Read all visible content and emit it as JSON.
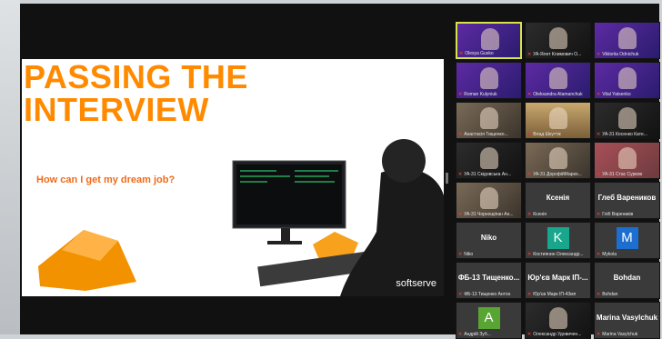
{
  "slide": {
    "title_line1": "PASSING THE",
    "title_line2": "INTERVIEW",
    "subtitle": "How can I get my dream job?",
    "brand": "softserve"
  },
  "participants": [
    {
      "label": "Olesya Gusko",
      "type": "video",
      "style": "vid-purple",
      "active": true
    },
    {
      "label": "УА-Ялет Климович О...",
      "type": "video",
      "style": "vid-dark"
    },
    {
      "label": "Viktoriia Odnichuk",
      "type": "video",
      "style": "vid-purple"
    },
    {
      "label": "Roman Kulyniuk",
      "type": "video",
      "style": "vid-purple"
    },
    {
      "label": "Oleksandra Atamanchuk",
      "type": "video",
      "style": "vid-purple"
    },
    {
      "label": "Vital Yatsenko",
      "type": "video",
      "style": "vid-purple"
    },
    {
      "label": "Анастасія Тищенко...",
      "type": "video",
      "style": "vid-room"
    },
    {
      "label": "Влад Шкуттік",
      "type": "video",
      "style": "vid-bridge"
    },
    {
      "label": "УА-31 Косенко Кате...",
      "type": "video",
      "style": "vid-dark"
    },
    {
      "label": "УА-31 Скідовська Ан...",
      "type": "video",
      "style": "vid-dark"
    },
    {
      "label": "УА-31 ДорофійМарко...",
      "type": "video",
      "style": "vid-room"
    },
    {
      "label": "УА-31 Стас Сурков",
      "type": "video",
      "style": "vid-flowers"
    },
    {
      "label": "УА-31 Чорнощіпан Ан...",
      "type": "video",
      "style": "vid-room"
    },
    {
      "label": "Ксенія",
      "type": "name",
      "name": "Ксенія"
    },
    {
      "label": "Гліб Вареників",
      "type": "name",
      "name": "Глеб Вареников"
    },
    {
      "label": "Niko",
      "type": "name",
      "name": "Niko"
    },
    {
      "label": "Костиянин Олександр...",
      "type": "avatar",
      "letter": "K",
      "color": "#18a78c"
    },
    {
      "label": "Mykola",
      "type": "avatar",
      "letter": "M",
      "color": "#1c6fd1"
    },
    {
      "label": "ФБ-13 Тищенко Антон",
      "type": "name",
      "name": "ФБ-13 Тищенко..."
    },
    {
      "label": "Юр'єв Марк ІП-43мп",
      "type": "name",
      "name": "Юр'єв Марк ІП-..."
    },
    {
      "label": "Bohdan",
      "type": "name",
      "name": "Bohdan"
    },
    {
      "label": "Андрій Зуб...",
      "type": "avatar",
      "letter": "A",
      "color": "#58a533"
    },
    {
      "label": "Олександр Удовичен...",
      "type": "video",
      "style": "vid-dark"
    },
    {
      "label": "Marina Vasylchuk",
      "type": "name",
      "name": "Marina Vasylchuk"
    }
  ]
}
